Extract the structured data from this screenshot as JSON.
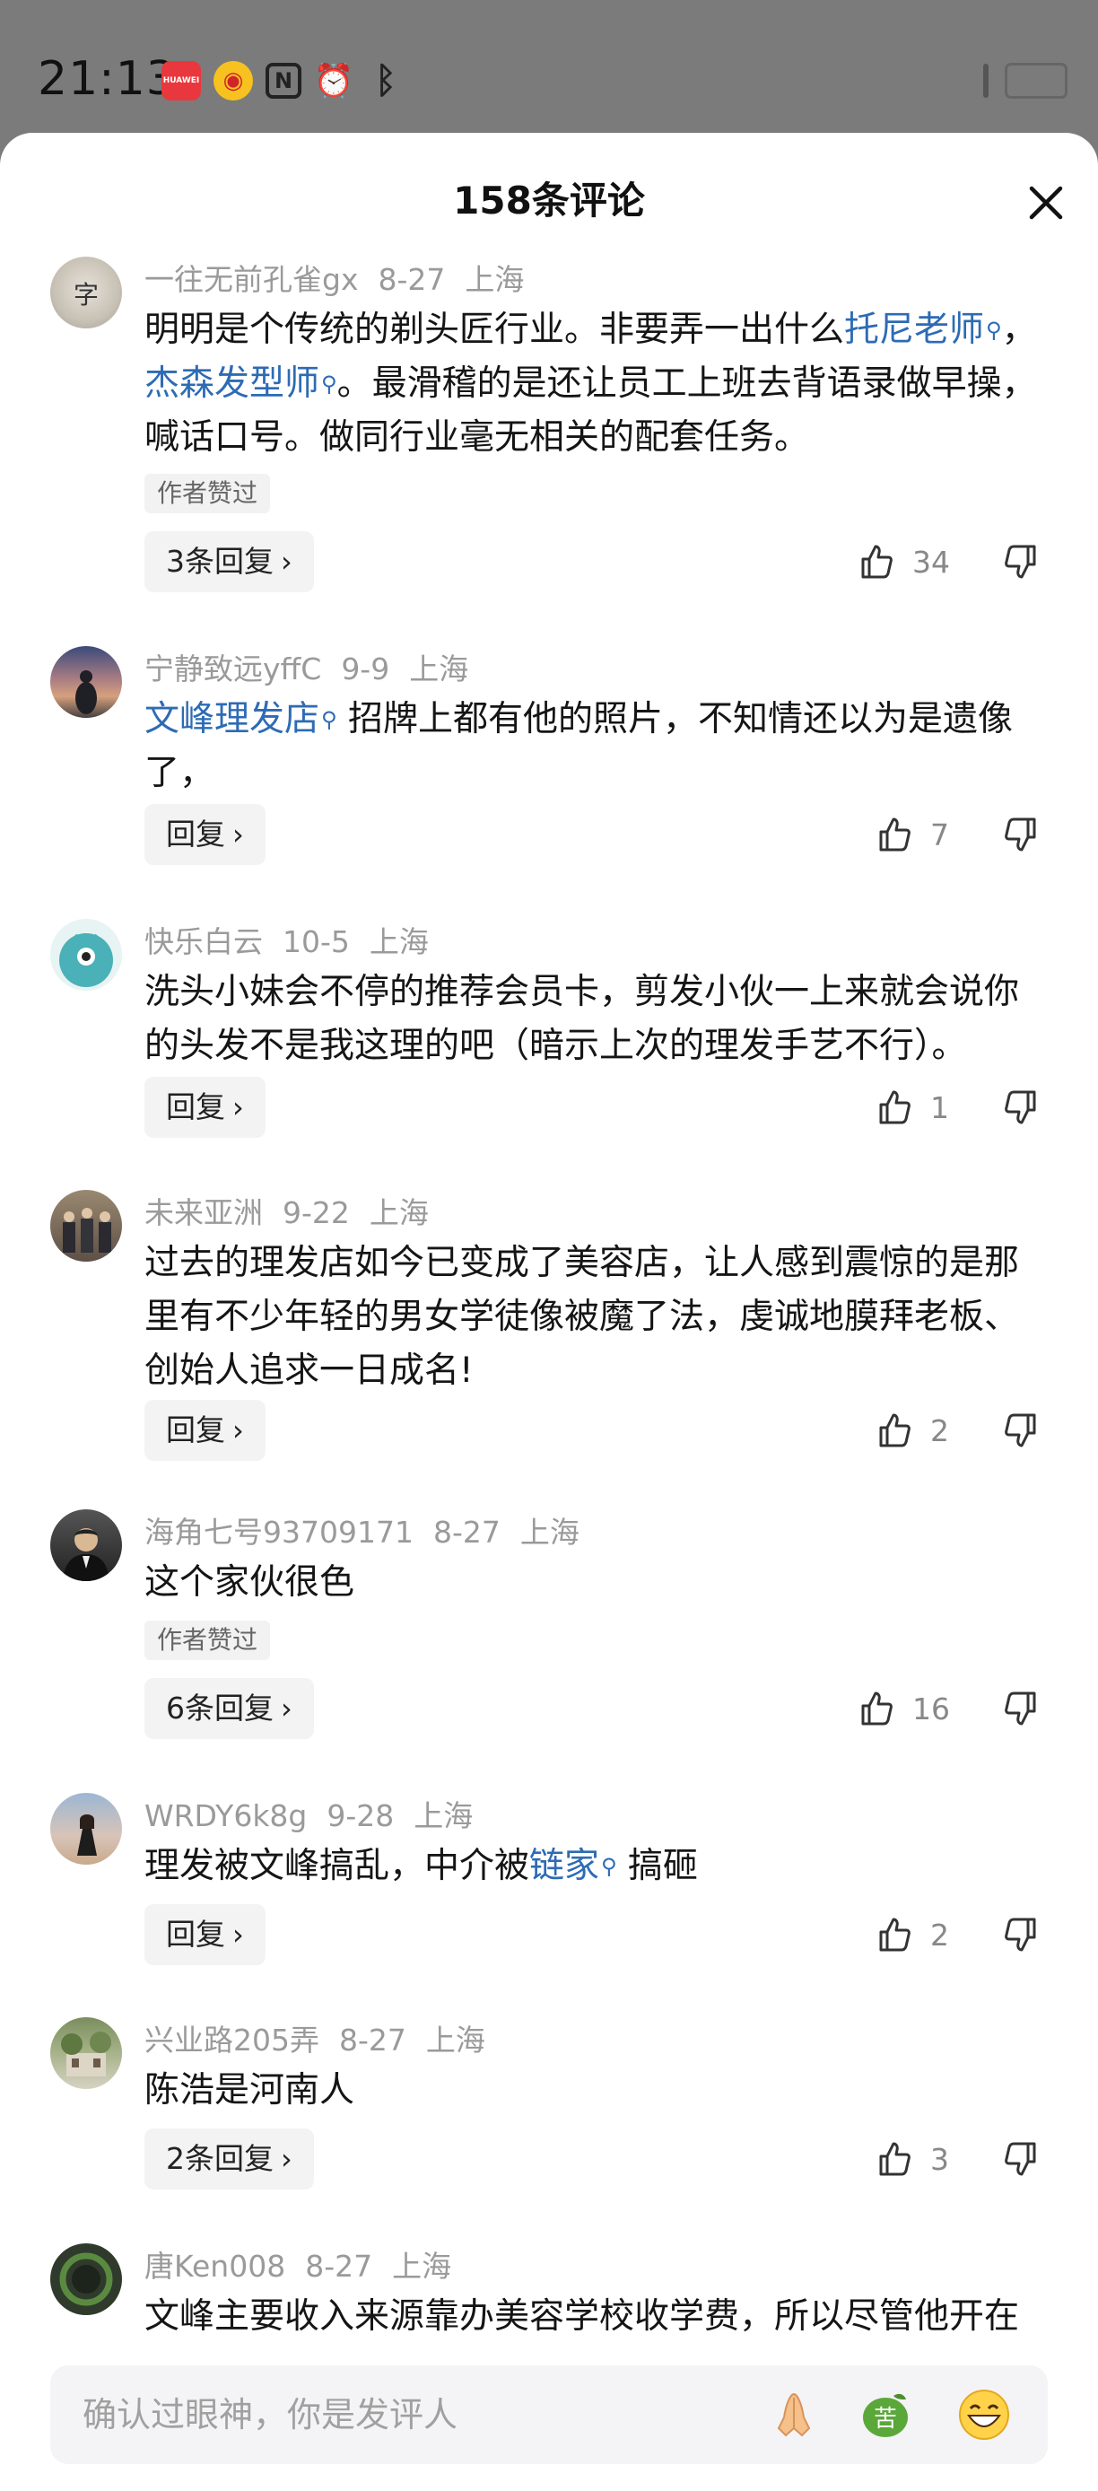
{
  "status_bar": {
    "time": "21:13",
    "icons": [
      "huawei-shop-icon",
      "weibo-icon",
      "nfc-icon",
      "alarm-icon",
      "bluetooth-icon"
    ]
  },
  "sheet": {
    "title": "158条评论"
  },
  "comments": [
    {
      "name": "一往无前孔雀gx",
      "date": "8-27",
      "location": "上海",
      "body_parts": [
        "明明是个传统的剃头匠行业。非要弄一出什么",
        "托尼老师",
        "，",
        "杰森发型师",
        "。最滑稽的是还让员工上班去背语录做早操，喊话口号。做同行业毫无相关的配套任务。"
      ],
      "author_liked": "作者赞过",
      "reply": "3条回复",
      "likes": "34"
    },
    {
      "name": "宁静致远yffC",
      "date": "9-9",
      "location": "上海",
      "body_parts": [
        "文峰理发店",
        " 招牌上都有他的照片，不知情还以为是遗像了，"
      ],
      "reply": "回复",
      "likes": "7"
    },
    {
      "name": "快乐白云",
      "date": "10-5",
      "location": "上海",
      "body": "洗头小妹会不停的推荐会员卡，剪发小伙一上来就会说你的头发不是我这理的吧（暗示上次的理发手艺不行）。",
      "reply": "回复",
      "likes": "1"
    },
    {
      "name": "未来亚洲",
      "date": "9-22",
      "location": "上海",
      "body": "过去的理发店如今已变成了美容店，让人感到震惊的是那里有不少年轻的男女学徒像被魔了法，虔诚地膜拜老板、创始人追求一日成名!",
      "reply": "回复",
      "likes": "2"
    },
    {
      "name": "海角七号93709171",
      "date": "8-27",
      "location": "上海",
      "body": "这个家伙很色",
      "author_liked": "作者赞过",
      "reply": "6条回复",
      "likes": "16"
    },
    {
      "name": "WRDY6k8g",
      "date": "9-28",
      "location": "上海",
      "body_parts": [
        "理发被文峰搞乱，中介被",
        "链家",
        " 搞砸"
      ],
      "reply": "回复",
      "likes": "2"
    },
    {
      "name": "兴业路205弄",
      "date": "8-27",
      "location": "上海",
      "body": "陈浩是河南人",
      "reply": "2条回复",
      "likes": "3"
    },
    {
      "name": "唐Ken008",
      "date": "8-27",
      "location": "上海",
      "body": "文峰主要收入来源靠办美容学校收学费，所以尽管他开在"
    }
  ],
  "input": {
    "placeholder": "确认过眼神，你是发评人",
    "emoji_icons": [
      "pray-emoji-icon",
      "bitter-emoji-icon",
      "grin-emoji-icon"
    ]
  },
  "colors": {
    "link": "#2d6bb4",
    "meta": "#9a9a9a",
    "background_dim": "#7b7b7b"
  }
}
